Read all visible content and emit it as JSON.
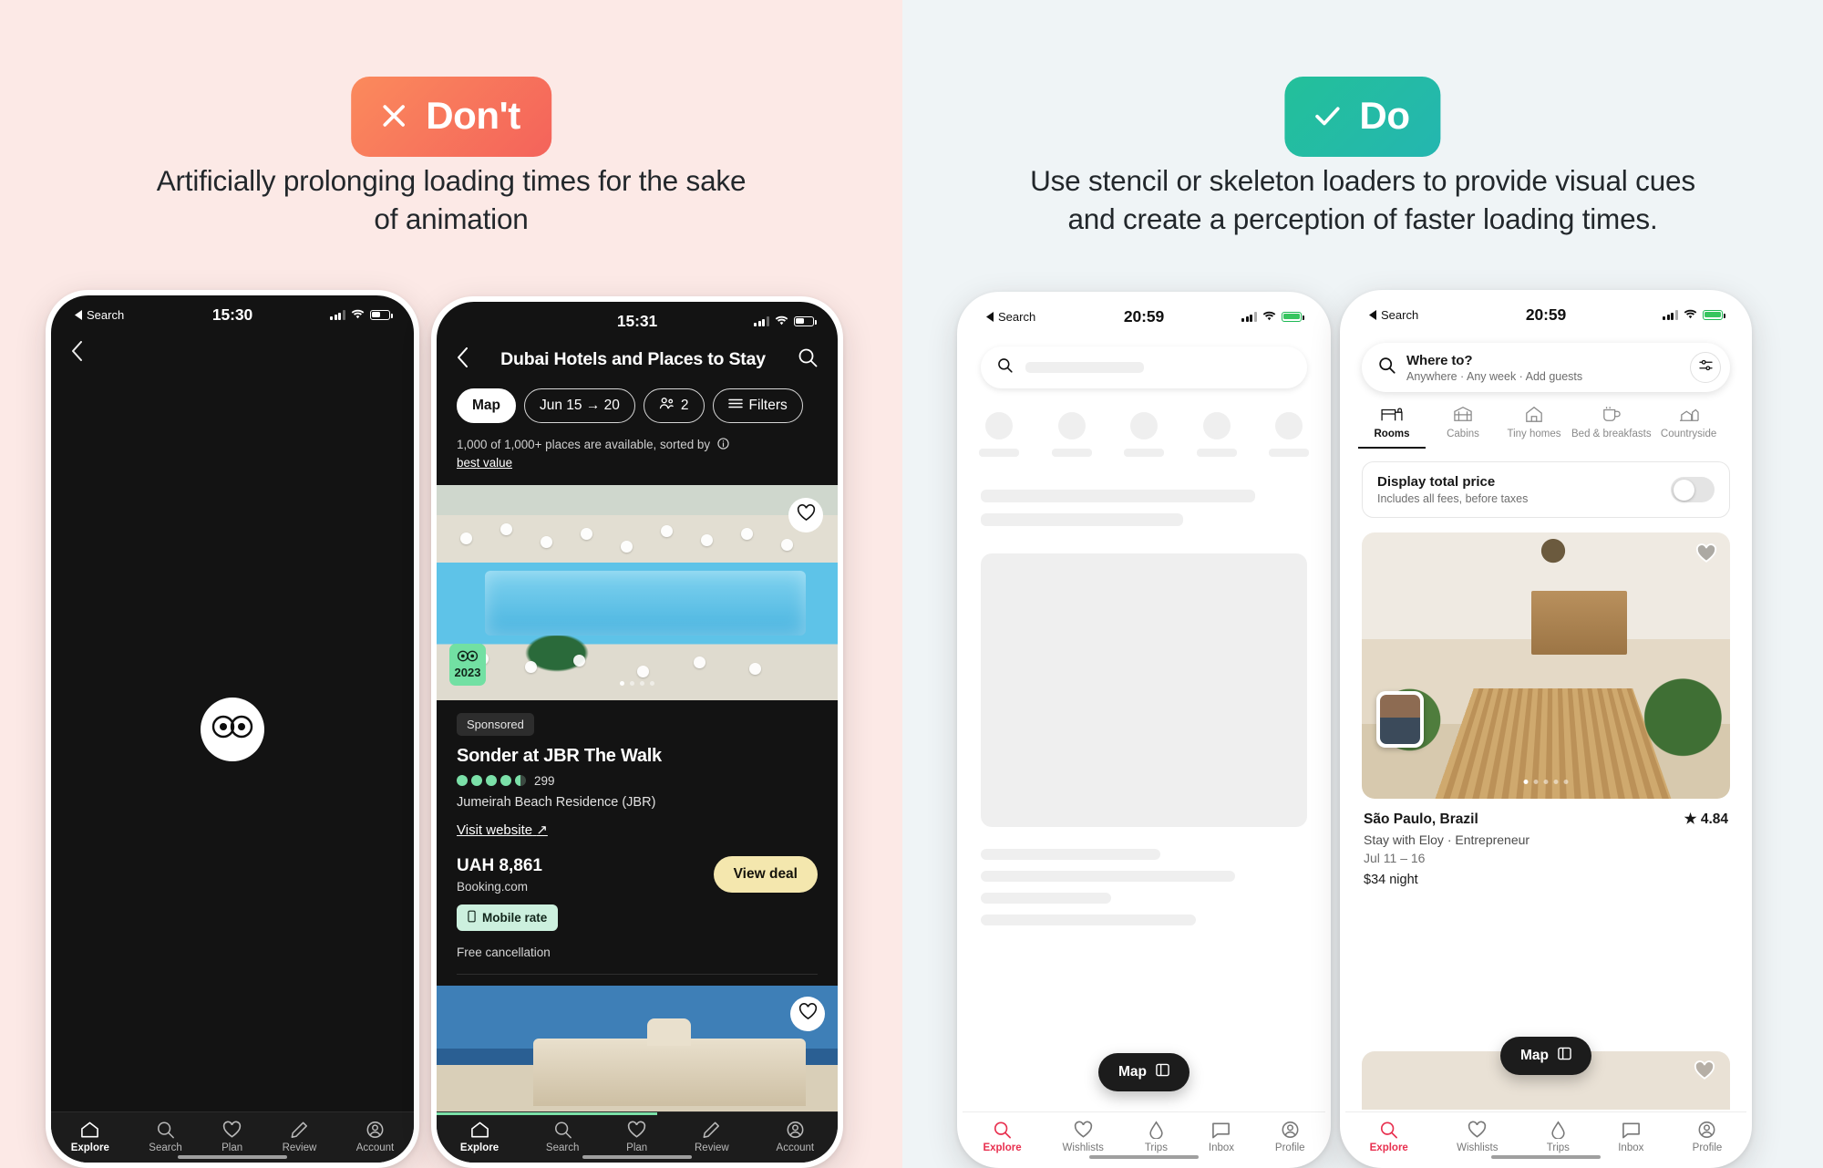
{
  "left_panel": {
    "badge": {
      "label": "Don't",
      "icon": "close-x-icon",
      "color": "#f4635b"
    },
    "caption": "Artificially prolonging loading times for the sake of animation"
  },
  "right_panel": {
    "badge": {
      "label": "Do",
      "icon": "check-icon",
      "color": "#23c09a"
    },
    "caption": "Use stencil or skeleton loaders to provide visual cues and create a perception of faster loading times."
  },
  "phone1": {
    "status": {
      "back_label": "Search",
      "time": "15:30"
    },
    "back_icon": "chevron-left-icon",
    "spinner_icon": "tripadvisor-owl-icon",
    "tabs": [
      {
        "label": "Explore",
        "icon": "home-icon",
        "active": true
      },
      {
        "label": "Search",
        "icon": "search-icon",
        "active": false
      },
      {
        "label": "Plan",
        "icon": "heart-icon",
        "active": false
      },
      {
        "label": "Review",
        "icon": "pencil-icon",
        "active": false
      },
      {
        "label": "Account",
        "icon": "account-icon",
        "active": false
      }
    ]
  },
  "phone2": {
    "status": {
      "time": "15:31"
    },
    "header": {
      "title": "Dubai Hotels and Places to Stay",
      "back_icon": "chevron-left-icon",
      "search_icon": "search-icon"
    },
    "filters": [
      {
        "label": "Map",
        "icon": "",
        "solid": true
      },
      {
        "label": "Jun 15 → 20",
        "icon": "",
        "solid": false
      },
      {
        "label": "2",
        "icon": "guests-icon",
        "solid": false
      },
      {
        "label": "Filters",
        "icon": "filters-icon",
        "solid": false
      }
    ],
    "sort_text": "1,000 of 1,000+ places are available, sorted by",
    "sort_link": "best value",
    "sort_info_icon": "info-icon",
    "card": {
      "award_year": "2023",
      "award_icon": "tripadvisor-owl-icon",
      "favorite_icon": "heart-icon",
      "sponsored": "Sponsored",
      "title": "Sonder at JBR The Walk",
      "reviews": "299",
      "rating_bubbles": 4.5,
      "location": "Jumeirah Beach Residence (JBR)",
      "website_link": "Visit website",
      "website_icon": "external-link-icon",
      "price": "UAH 8,861",
      "provider": "Booking.com",
      "cta": "View deal",
      "mobile_rate": "Mobile rate",
      "mobile_rate_icon": "phone-icon",
      "cancellation": "Free cancellation"
    },
    "card2": {
      "favorite_icon": "heart-icon"
    },
    "tabs": [
      {
        "label": "Explore",
        "icon": "home-icon",
        "active": true
      },
      {
        "label": "Search",
        "icon": "search-icon",
        "active": false
      },
      {
        "label": "Plan",
        "icon": "heart-icon",
        "active": false
      },
      {
        "label": "Review",
        "icon": "pencil-icon",
        "active": false
      },
      {
        "label": "Account",
        "icon": "account-icon",
        "active": false
      }
    ]
  },
  "phone3": {
    "status": {
      "back_label": "Search",
      "time": "20:59"
    },
    "search_icon": "search-icon",
    "map_button": {
      "label": "Map",
      "icon": "map-toggle-icon"
    },
    "tabs": [
      {
        "label": "Explore",
        "icon": "search-icon",
        "active": true
      },
      {
        "label": "Wishlists",
        "icon": "heart-icon",
        "active": false
      },
      {
        "label": "Trips",
        "icon": "airbnb-icon",
        "active": false
      },
      {
        "label": "Inbox",
        "icon": "message-icon",
        "active": false
      },
      {
        "label": "Profile",
        "icon": "account-icon",
        "active": false
      }
    ]
  },
  "phone4": {
    "status": {
      "back_label": "Search",
      "time": "20:59"
    },
    "search": {
      "icon": "search-icon",
      "title": "Where to?",
      "subtitle": "Anywhere · Any week · Add guests",
      "filter_icon": "filters-icon"
    },
    "categories": [
      {
        "label": "Rooms",
        "icon": "bed-icon",
        "active": true
      },
      {
        "label": "Cabins",
        "icon": "cabin-icon",
        "active": false
      },
      {
        "label": "Tiny homes",
        "icon": "tiny-home-icon",
        "active": false
      },
      {
        "label": "Bed & breakfasts",
        "icon": "breakfast-icon",
        "active": false
      },
      {
        "label": "Countryside",
        "icon": "countryside-icon",
        "active": false
      }
    ],
    "total_price": {
      "title": "Display total price",
      "subtitle": "Includes all fees, before taxes",
      "enabled": false
    },
    "listing": {
      "favorite_icon": "heart-icon",
      "host_avatar": "host-avatar",
      "location": "São Paulo, Brazil",
      "rating": "4.84",
      "rating_icon": "star-icon",
      "host_line": "Stay with Eloy · Entrepreneur",
      "dates": "Jul 11 – 16",
      "price": "$34 night"
    },
    "map_button": {
      "label": "Map",
      "icon": "map-toggle-icon"
    },
    "tabs": [
      {
        "label": "Explore",
        "icon": "search-icon",
        "active": true
      },
      {
        "label": "Wishlists",
        "icon": "heart-icon",
        "active": false
      },
      {
        "label": "Trips",
        "icon": "airbnb-icon",
        "active": false
      },
      {
        "label": "Inbox",
        "icon": "message-icon",
        "active": false
      },
      {
        "label": "Profile",
        "icon": "account-icon",
        "active": false
      }
    ]
  }
}
